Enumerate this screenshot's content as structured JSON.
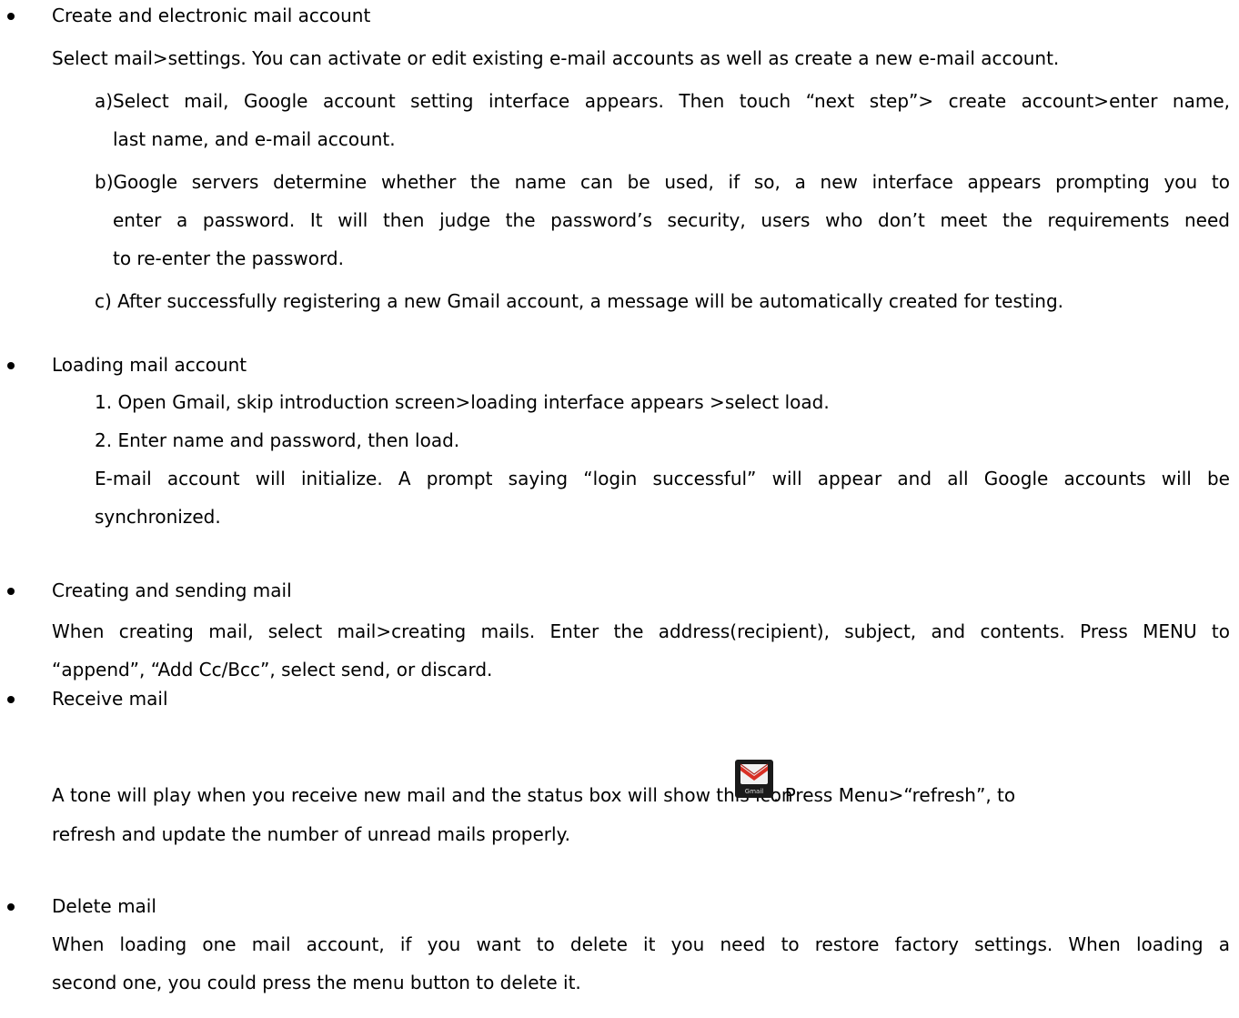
{
  "sections": {
    "create": {
      "heading": "Create and electronic mail account",
      "intro": "Select mail>settings. You can activate or edit existing e-mail accounts as well as create a new e-mail account.",
      "item_a_line1": "a)Select mail, Google account setting interface appears. Then touch “next step”> create account>enter name,",
      "item_a_line2": "last name, and e-mail account.",
      "item_b_line1": "b)Google servers determine whether the name can be used, if so, a new interface appears prompting you to",
      "item_b_line2": "enter a password. It will then judge the password’s security, users who don’t meet the requirements need",
      "item_b_line3": "to re-enter the password.",
      "item_c": "c) After successfully registering a new Gmail account, a message will be automatically created for testing."
    },
    "loading": {
      "heading": "Loading mail account",
      "step1": "1. Open Gmail, skip introduction screen>loading interface appears >select load.",
      "step2": "2. Enter name and password, then load.",
      "note_line1": "E-mail account will initialize. A prompt saying “login successful” will appear and all Google accounts will be",
      "note_line2": "synchronized."
    },
    "sending": {
      "heading": "Creating and sending mail",
      "body_line1": "When creating mail, select mail>creating mails. Enter the address(recipient), subject, and contents. Press MENU to",
      "body_line2": "“append”, “Add Cc/Bcc”, select send, or discard."
    },
    "receive": {
      "heading": "Receive mail",
      "body_line1_before": "A tone will play when you receive new mail and the status box will show this icon",
      "body_line1_after": ". Press Menu>“refresh”, to",
      "body_line2": "refresh and update the number of unread mails properly.",
      "icon_label": "Gmail",
      "icon": "gmail-icon"
    },
    "delete": {
      "heading": "Delete mail",
      "body_line1": "When loading one mail account, if you want to delete it you need to restore factory settings. When loading a",
      "body_line2": "second one, you could press the menu button to delete it."
    }
  },
  "colors": {
    "text": "#000000",
    "icon_background": "#1a1a1a",
    "gmail_red": "#d93025"
  }
}
